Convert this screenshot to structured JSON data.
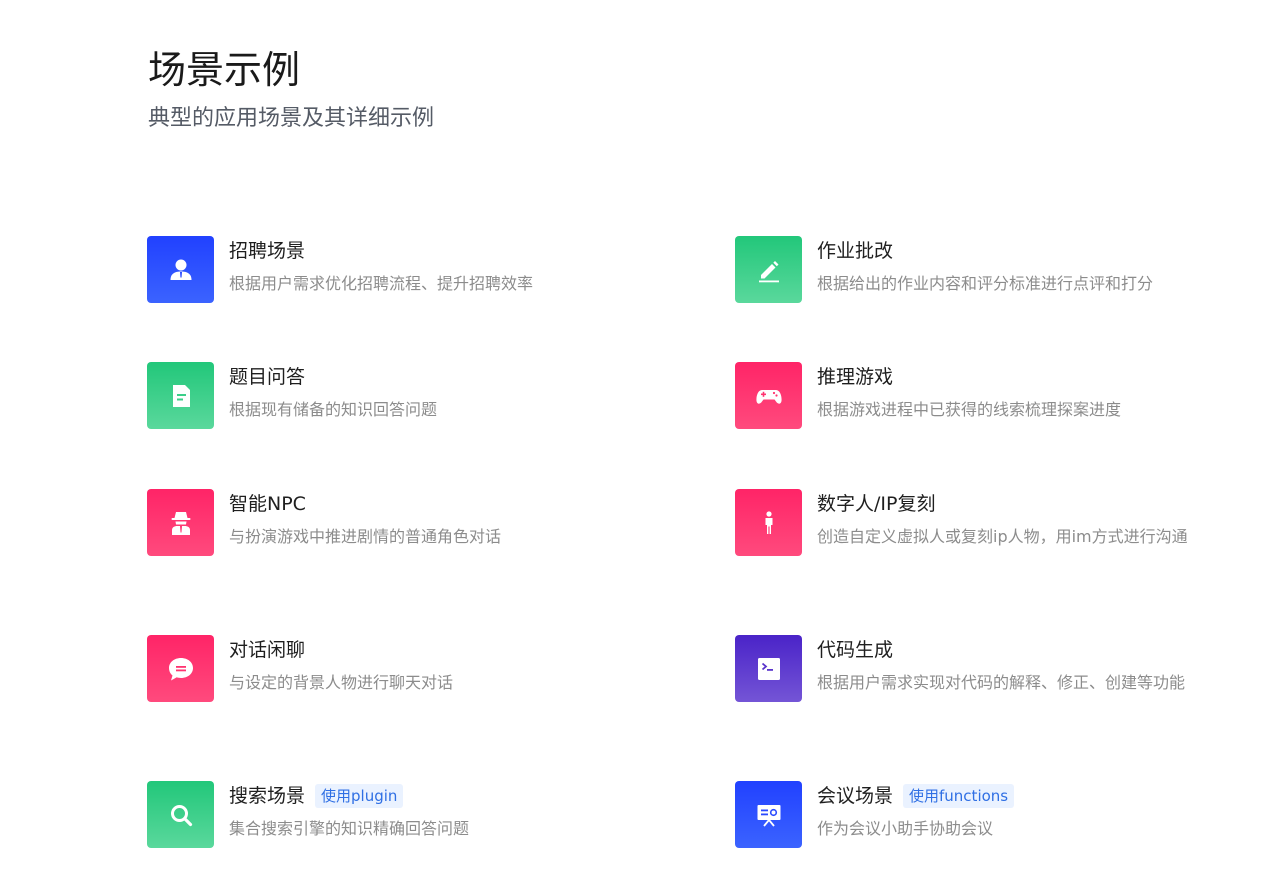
{
  "header": {
    "title": "场景示例",
    "subtitle": "典型的应用场景及其详细示例"
  },
  "cards": [
    {
      "title": "招聘场景",
      "desc": "根据用户需求优化招聘流程、提升招聘效率",
      "icon": "user-icon",
      "color": "#2141ff"
    },
    {
      "title": "作业批改",
      "desc": "根据给出的作业内容和评分标准进行点评和打分",
      "icon": "pencil-icon",
      "color": "#22c77a"
    },
    {
      "title": "题目问答",
      "desc": "根据现有储备的知识回答问题",
      "icon": "document-icon",
      "color": "#22c77a"
    },
    {
      "title": "推理游戏",
      "desc": "根据游戏进程中已获得的线索梳理探案进度",
      "icon": "gamepad-icon",
      "color": "#ff2467"
    },
    {
      "title": "智能NPC",
      "desc": "与扮演游戏中推进剧情的普通角色对话",
      "icon": "spy-icon",
      "color": "#ff2467"
    },
    {
      "title": "数字人/IP复刻",
      "desc": "创造自定义虚拟人或复刻ip人物，用im方式进行沟通",
      "icon": "person-icon",
      "color": "#ff2467"
    },
    {
      "title": "对话闲聊",
      "desc": "与设定的背景人物进行聊天对话",
      "icon": "chat-icon",
      "color": "#ff2467"
    },
    {
      "title": "代码生成",
      "desc": "根据用户需求实现对代码的解释、修正、创建等功能",
      "icon": "terminal-icon",
      "color": "#4a23c8"
    },
    {
      "title": "搜索场景",
      "tag": "使用plugin",
      "desc": "集合搜索引擎的知识精确回答问题",
      "icon": "search-icon",
      "color": "#22c77a"
    },
    {
      "title": "会议场景",
      "tag": "使用functions",
      "desc": "作为会议小助手协助会议",
      "icon": "presentation-icon",
      "color": "#2141ff"
    }
  ]
}
